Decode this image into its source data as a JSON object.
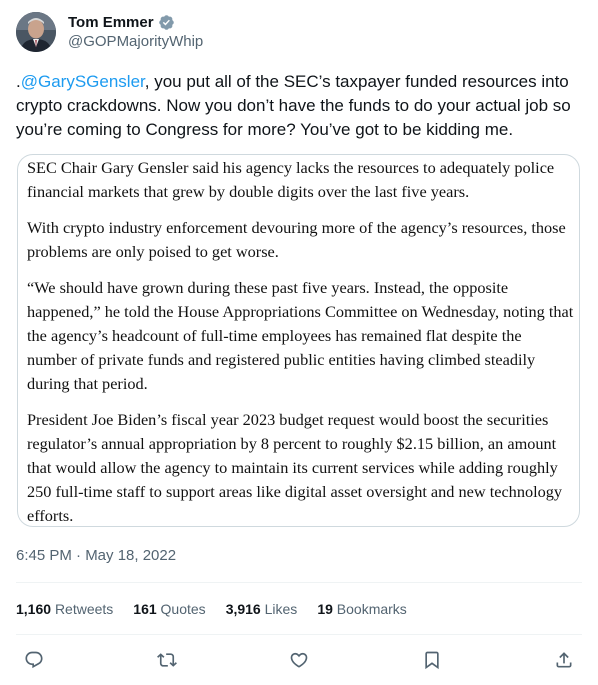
{
  "author": {
    "name": "Tom Emmer",
    "handle": "@GOPMajorityWhip",
    "verified_color": "#829aab"
  },
  "tweet": {
    "prefix": ".",
    "mention": "@GarySGensler",
    "text": ", you put all of the SEC’s taxpayer funded resources into crypto crackdowns. Now you don’t have the funds to do your actual job so you’re coming to Congress for more? You’ve got to be kidding me.",
    "mention_color": "#1d9bf0"
  },
  "quote": {
    "paragraphs": [
      "SEC Chair Gary Gensler said his agency lacks the resources to adequately police financial markets that grew by double digits over the last five years.",
      "With crypto industry enforcement devouring more of the agency’s resources, those problems are only poised to get worse.",
      "“We should have grown during these past five years. Instead, the opposite happened,” he told the House Appropriations Committee on Wednesday, noting that the agency’s headcount of full-time employees has remained flat despite the number of private funds and registered public entities having climbed steadily during that period.",
      "President Joe Biden’s fiscal year 2023 budget request would boost the securities regulator’s annual appropriation by 8 percent to roughly $2.15 billion, an amount that would allow the agency to maintain its current services while adding roughly 250 full-time staff to support areas like digital asset oversight and new technology efforts."
    ]
  },
  "timestamp": "6:45 PM · May 18, 2022",
  "stats": {
    "retweets_count": "1,160",
    "retweets_label": "Retweets",
    "quotes_count": "161",
    "quotes_label": "Quotes",
    "likes_count": "3,916",
    "likes_label": "Likes",
    "bookmarks_count": "19",
    "bookmarks_label": "Bookmarks"
  },
  "actions": [
    {
      "icon": "reply-icon"
    },
    {
      "icon": "retweet-icon"
    },
    {
      "icon": "like-icon"
    },
    {
      "icon": "bookmark-icon"
    },
    {
      "icon": "share-icon"
    }
  ]
}
